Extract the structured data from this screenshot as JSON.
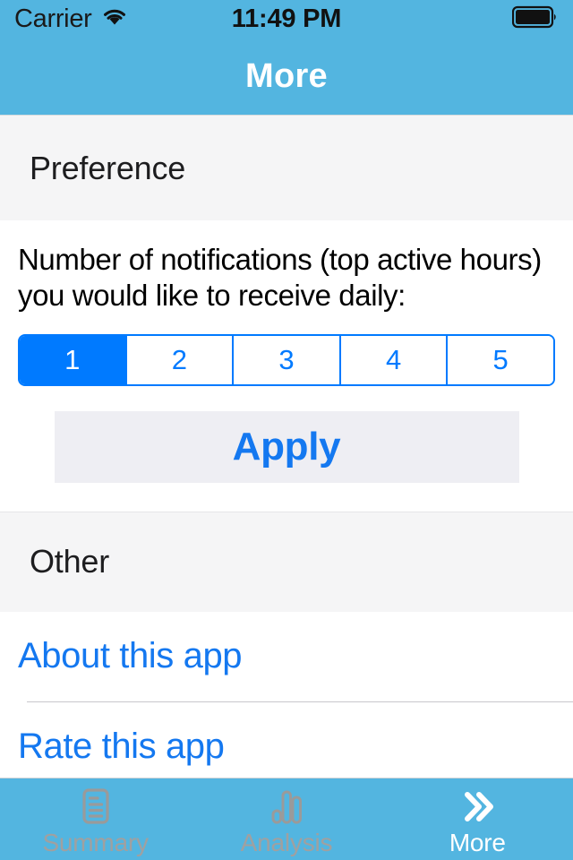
{
  "status_bar": {
    "carrier": "Carrier",
    "wifi_icon": "wifi-icon",
    "time": "11:49 PM",
    "battery_icon": "battery-full-icon"
  },
  "nav_bar": {
    "title": "More"
  },
  "sections": {
    "preference": {
      "header": "Preference",
      "description": "Number of notifications (top active hours) you would like to receive daily:",
      "segmented_control": {
        "options": [
          "1",
          "2",
          "3",
          "4",
          "5"
        ],
        "selected_index": 0,
        "selected_value": "1"
      },
      "apply_button": "Apply"
    },
    "other": {
      "header": "Other",
      "items": [
        {
          "label": "About this app"
        },
        {
          "label": "Rate this app"
        }
      ]
    }
  },
  "tab_bar": {
    "tabs": [
      {
        "label": "Summary",
        "icon": "document-list-icon",
        "active": false
      },
      {
        "label": "Analysis",
        "icon": "bar-chart-icon",
        "active": false
      },
      {
        "label": "More",
        "icon": "double-chevron-right-icon",
        "active": true
      }
    ]
  },
  "colors": {
    "nav_background": "#53b5e0",
    "accent_blue": "#007aff",
    "link_blue": "#1478f0",
    "section_header_background": "#f5f5f6",
    "apply_background": "#eeeef3",
    "tab_inactive": "#a0a0a0",
    "tab_active": "#ffffff"
  }
}
